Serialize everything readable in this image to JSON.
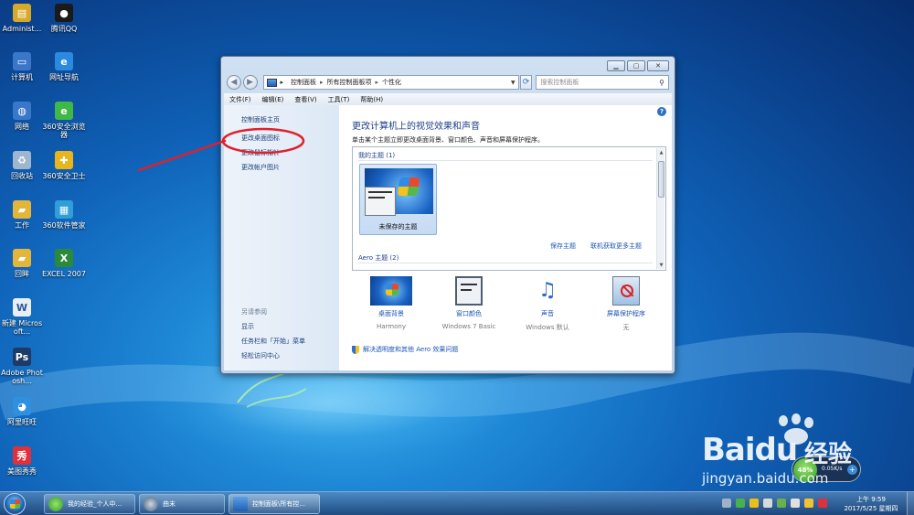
{
  "desktop": {
    "icons": [
      {
        "label": "Administ...",
        "icon": "user-folder-icon",
        "color": "#d7a92a"
      },
      {
        "label": "腾讯QQ",
        "icon": "qq-penguin-icon",
        "color": "#1a1a1a"
      },
      {
        "label": "计算机",
        "icon": "computer-icon",
        "color": "#3a77c9"
      },
      {
        "label": "网址导航",
        "icon": "ie-icon",
        "color": "#2a8ae0"
      },
      {
        "label": "网络",
        "icon": "network-icon",
        "color": "#3a77c9"
      },
      {
        "label": "360安全浏览器",
        "icon": "360-browser-icon",
        "color": "#3fb846"
      },
      {
        "label": "回收站",
        "icon": "recycle-bin-icon",
        "color": "#9fb6cf"
      },
      {
        "label": "360安全卫士",
        "icon": "360-guard-icon",
        "color": "#e8b51c"
      },
      {
        "label": "工作",
        "icon": "folder-icon",
        "color": "#e3b53a"
      },
      {
        "label": "360软件管家",
        "icon": "360-software-icon",
        "color": "#2f9ed9"
      },
      {
        "label": "回眸",
        "icon": "folder-icon",
        "color": "#e3b53a"
      },
      {
        "label": "EXCEL 2007",
        "icon": "excel-icon",
        "color": "#2a8a3a"
      },
      {
        "label": "新建 Microsoft...",
        "icon": "word-doc-icon",
        "color": "#e9eef5"
      },
      {
        "label": "Adobe Photosh...",
        "icon": "photoshop-icon",
        "color": "#1c3b66"
      },
      {
        "label": "阿里旺旺",
        "icon": "aliwangwang-icon",
        "color": "#2f8fe0"
      },
      {
        "label": "美图秀秀",
        "icon": "meitu-icon",
        "color": "#e0303a"
      }
    ]
  },
  "window": {
    "address": {
      "root": "控制面板",
      "mid": "所有控制面板项",
      "current": "个性化"
    },
    "search_placeholder": "搜索控制面板",
    "menu": [
      "文件(F)",
      "编辑(E)",
      "查看(V)",
      "工具(T)",
      "帮助(H)"
    ],
    "left_links": [
      "控制面板主页",
      "更改桌面图标",
      "更改鼠标指针",
      "更改帐户图片"
    ],
    "see_also_title": "另请参阅",
    "see_also_links": [
      "显示",
      "任务栏和「开始」菜单",
      "轻松访问中心"
    ],
    "heading": "更改计算机上的视觉效果和声音",
    "subheading": "单击某个主题立即更改桌面背景、窗口颜色、声音和屏幕保护程序。",
    "my_themes_label": "我的主题 (1)",
    "unsaved_theme": "未保存的主题",
    "save_theme": "保存主题",
    "get_more": "联机获取更多主题",
    "aero_label": "Aero 主题 (2)",
    "options": [
      {
        "title": "桌面背景",
        "value": "Harmony",
        "icon": "desktop-background-icon"
      },
      {
        "title": "窗口颜色",
        "value": "Windows 7 Basic",
        "icon": "window-color-icon"
      },
      {
        "title": "声音",
        "value": "Windows 默认",
        "icon": "sound-icon"
      },
      {
        "title": "屏幕保护程序",
        "value": "无",
        "icon": "screensaver-icon"
      }
    ],
    "footer_link": "解决透明度和其他 Aero 效果问题"
  },
  "taskbar": {
    "items": [
      "我的经验_个人中...",
      "曲末",
      "控制面板\\所有控..."
    ],
    "time": "上午 9:59",
    "date": "2017/5/25 星期四"
  },
  "net_widget": {
    "percent": "48%",
    "speed": "0.05K/s"
  },
  "watermark": {
    "brand": "Bai",
    "brand2": "du",
    "brand_cn": "经验",
    "url": "jingyan.baidu.com"
  },
  "colors": {
    "accent": "#1a55b4",
    "annotation": "#e0202a"
  }
}
